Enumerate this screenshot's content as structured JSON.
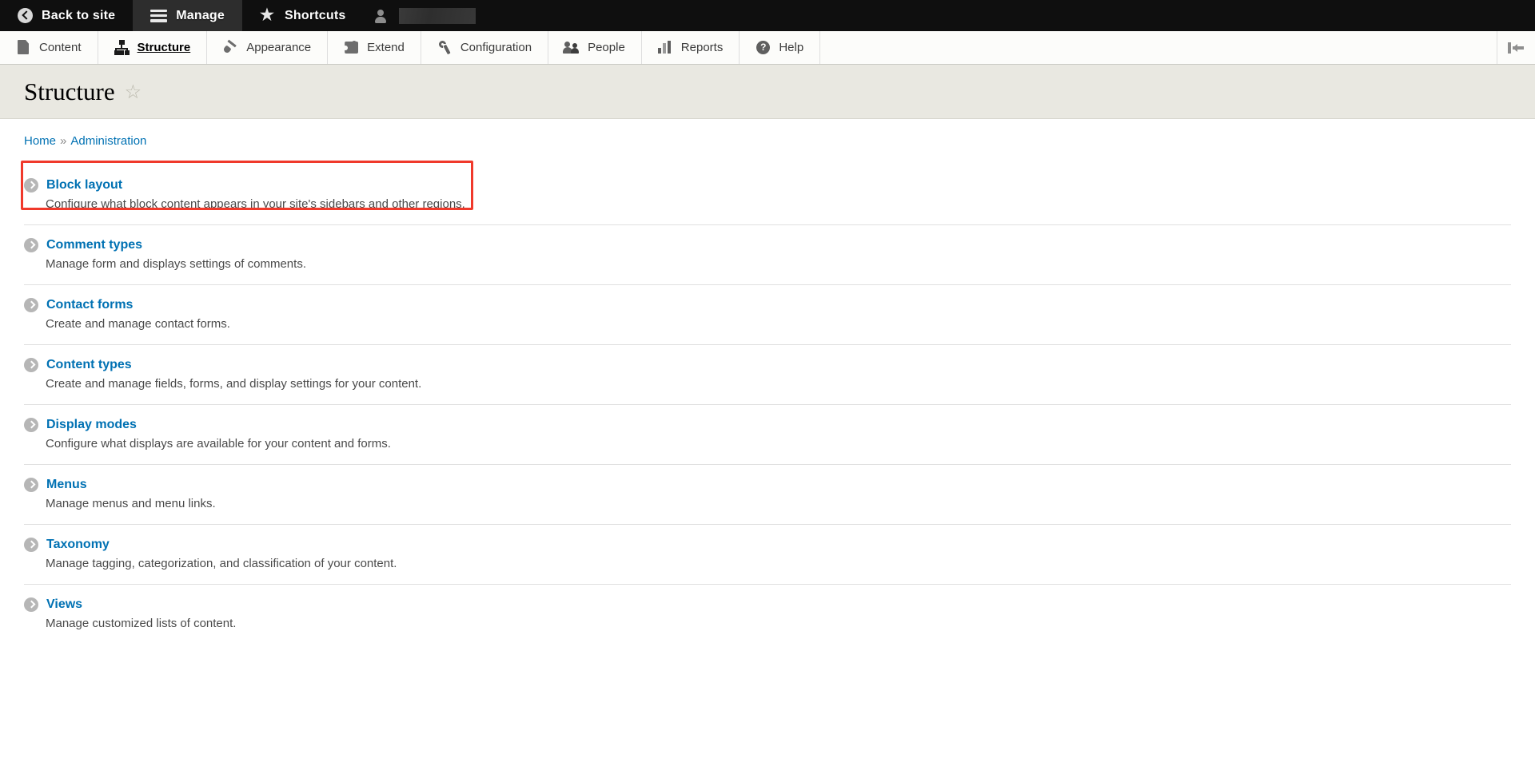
{
  "toolbar": {
    "tabs": [
      {
        "label": "Back to site",
        "icon": "back-arrow-icon",
        "active": false
      },
      {
        "label": "Manage",
        "icon": "hamburger-icon",
        "active": true
      },
      {
        "label": "Shortcuts",
        "icon": "star-icon",
        "active": false
      }
    ],
    "user": {
      "icon": "user-icon",
      "name": ""
    }
  },
  "admin_menu": {
    "items": [
      {
        "label": "Content",
        "icon": "document-icon",
        "active": false
      },
      {
        "label": "Structure",
        "icon": "structure-icon",
        "active": true
      },
      {
        "label": "Appearance",
        "icon": "paintbrush-icon",
        "active": false
      },
      {
        "label": "Extend",
        "icon": "puzzle-icon",
        "active": false
      },
      {
        "label": "Configuration",
        "icon": "wrench-icon",
        "active": false
      },
      {
        "label": "People",
        "icon": "people-icon",
        "active": false
      },
      {
        "label": "Reports",
        "icon": "bar-chart-icon",
        "active": false
      },
      {
        "label": "Help",
        "icon": "question-icon",
        "active": false
      }
    ],
    "orientation_toggle": "orientation-toggle-icon"
  },
  "page": {
    "title": "Structure",
    "shortcut_star": "☆"
  },
  "breadcrumb": {
    "home": "Home",
    "separator": "»",
    "current": "Administration"
  },
  "admin_list": [
    {
      "title": "Block layout",
      "description": "Configure what block content appears in your site's sidebars and other regions.",
      "highlighted": true
    },
    {
      "title": "Comment types",
      "description": "Manage form and displays settings of comments.",
      "highlighted": false
    },
    {
      "title": "Contact forms",
      "description": "Create and manage contact forms.",
      "highlighted": false
    },
    {
      "title": "Content types",
      "description": "Create and manage fields, forms, and display settings for your content.",
      "highlighted": false
    },
    {
      "title": "Display modes",
      "description": "Configure what displays are available for your content and forms.",
      "highlighted": false
    },
    {
      "title": "Menus",
      "description": "Manage menus and menu links.",
      "highlighted": false
    },
    {
      "title": "Taxonomy",
      "description": "Manage tagging, categorization, and classification of your content.",
      "highlighted": false
    },
    {
      "title": "Views",
      "description": "Manage customized lists of content.",
      "highlighted": false
    }
  ],
  "colors": {
    "highlight": "#f0392b",
    "link": "#0071b3",
    "toolbar_bg": "#0f0f0f",
    "header_band": "#e9e8e1"
  }
}
